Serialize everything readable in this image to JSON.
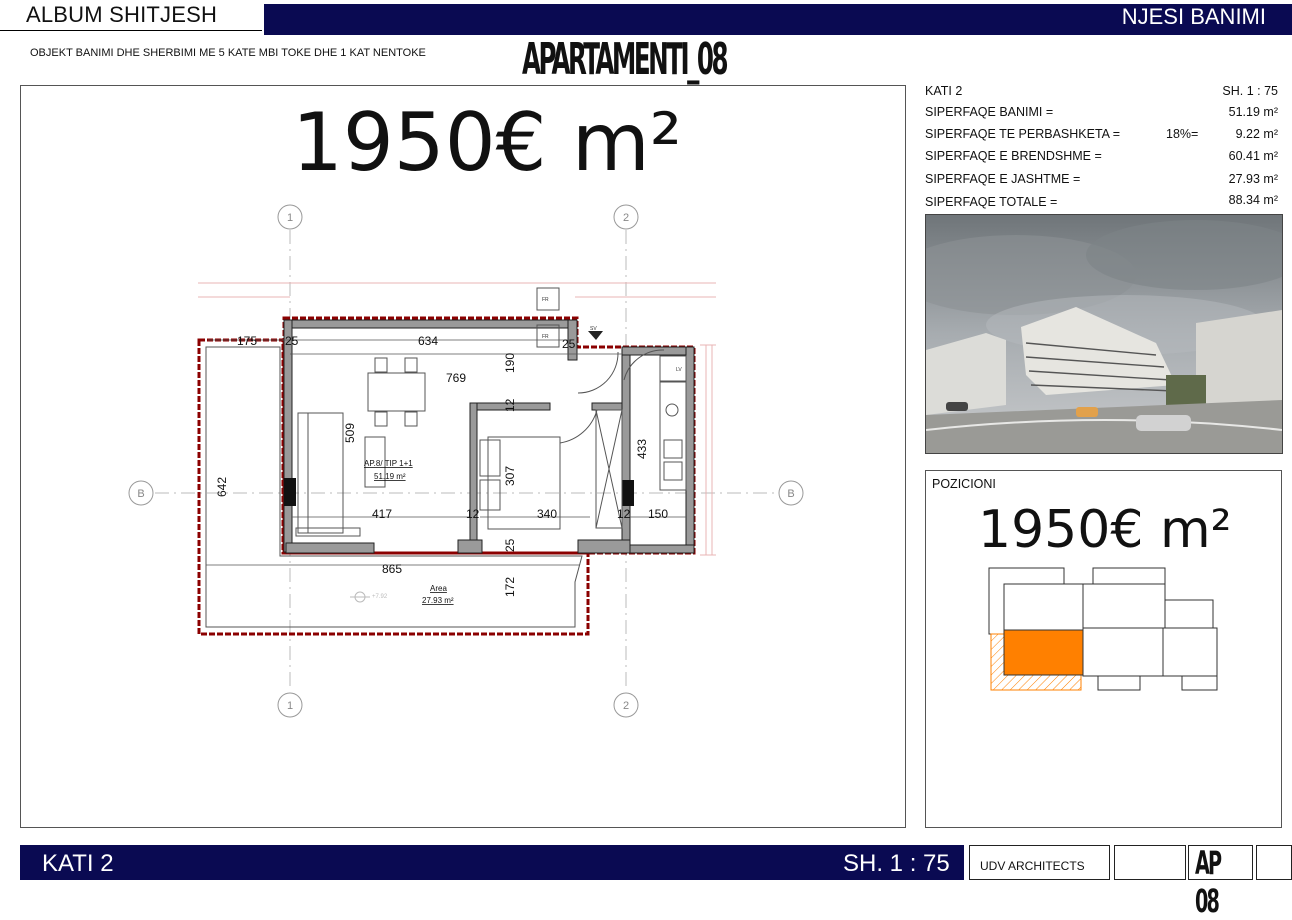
{
  "header": {
    "album_title": "ALBUM SHITJESH",
    "section_title": "NJESI BANIMI",
    "subtitle": "OBJEKT BANIMI DHE SHERBIMI ME 5 KATE MBI TOKE DHE 1 KAT NENTOKE",
    "apartment_title": "APARTAMENTI_08"
  },
  "price": "1950€ m²",
  "info": {
    "floor": "KATI 2",
    "scale": "SH. 1 : 75",
    "rows": [
      {
        "label": "SIPERFAQE BANIMI =",
        "extra": "",
        "value": "51.19 m²"
      },
      {
        "label": "SIPERFAQE TE PERBASHKETA =",
        "extra": "18%=",
        "value": "9.22 m²"
      },
      {
        "label": "SIPERFAQE E BRENDSHME =",
        "extra": "",
        "value": "60.41 m²"
      },
      {
        "label": "SIPERFAQE E JASHTME =",
        "extra": "",
        "value": "27.93 m²"
      },
      {
        "label": "SIPERFAQE TOTALE  =",
        "extra": "",
        "value": "88.34 m²"
      }
    ]
  },
  "position": {
    "label": "POZICIONI",
    "price": "1950€ m²",
    "highlight_color": "#ff8000"
  },
  "plan": {
    "grid_labels": {
      "col1": "1",
      "col2": "2",
      "row": "B"
    },
    "dimensions": [
      "175",
      "25",
      "634",
      "25",
      "190",
      "769",
      "509",
      "642",
      "417",
      "12",
      "340",
      "12",
      "150",
      "307",
      "433",
      "12",
      "25",
      "865",
      "172"
    ],
    "apartment_tag": "AP.8/ TIP 1+1",
    "apartment_area": "51.19 m²",
    "terrace_label": "Area",
    "terrace_area": "27.93 m²",
    "level": "+7.92",
    "fridge_label": "FR",
    "riser_label": "SV",
    "lv_label": "LV"
  },
  "footer": {
    "floor": "KATI 2",
    "scale": "SH. 1 : 75",
    "architect": "UDV ARCHITECTS",
    "code": "AP 08"
  },
  "colors": {
    "navy": "#0a0a52",
    "wall": "#8b0000",
    "highlight": "#ff8000"
  }
}
